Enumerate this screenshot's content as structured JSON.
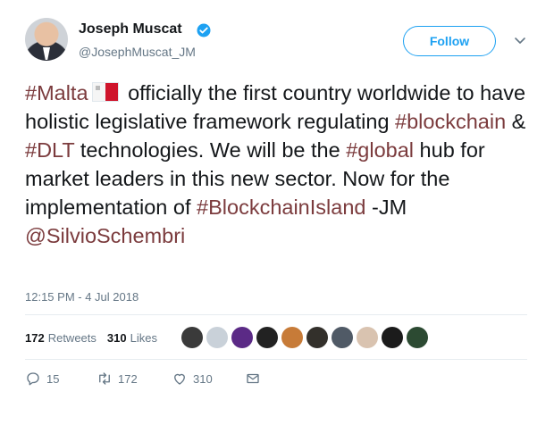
{
  "profile": {
    "name": "Joseph Muscat",
    "handle": "@JosephMuscat_JM",
    "follow_label": "Follow"
  },
  "tweet": {
    "seg": [
      "#Malta",
      " officially the first country worldwide to have holistic legislative framework regulating ",
      "#blockchain",
      " & ",
      "#DLT",
      " technologies. We will be the ",
      "#global",
      " hub for market leaders in this new sector. Now for the implementation of ",
      "#BlockchainIsland",
      " -JM ",
      "@SilvioSchembri"
    ],
    "timestamp": "12:15 PM - 4 Jul 2018"
  },
  "stats": {
    "retweets_count": "172",
    "retweets_label": "Retweets",
    "likes_count": "310",
    "likes_label": "Likes"
  },
  "likers": {
    "colors": [
      "#3a3a3a",
      "#c9d1d9",
      "#5b2a86",
      "#222222",
      "#c77b38",
      "#33302b",
      "#505a66",
      "#d9c3b0",
      "#1b1b1b",
      "#2c4a32"
    ]
  },
  "actions": {
    "reply_count": "15",
    "retweet_count": "172",
    "like_count": "310"
  },
  "colors": {
    "accent": "#1da1f2",
    "hashtag": "#7b3b3d",
    "secondary_text": "#657786"
  },
  "icons": [
    "verified-icon",
    "chevron-down-icon",
    "flag-malta-icon",
    "reply-icon",
    "retweet-icon",
    "heart-icon",
    "message-icon"
  ]
}
